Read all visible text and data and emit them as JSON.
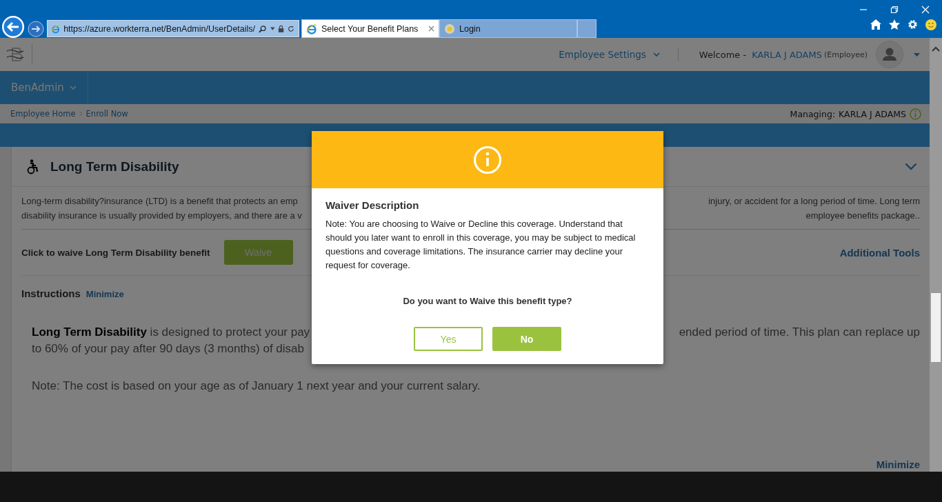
{
  "browser": {
    "address": "https://azure.workterra.net/BenAdmin/UserDetails/",
    "tabs": [
      {
        "title": "Select Your Benefit Plans",
        "selected": true
      },
      {
        "title": "Login",
        "selected": false
      }
    ]
  },
  "header": {
    "settings": "Employee Settings",
    "welcome": "Welcome -",
    "user_name": "KARLA J ADAMS",
    "user_role": "(Employee)"
  },
  "nav": {
    "menu": "BenAdmin"
  },
  "breadcrumb": [
    "Employee Home",
    "Enroll Now"
  ],
  "managing": {
    "label": "Managing:",
    "name": "KARLA J ADAMS"
  },
  "benefit": {
    "title": "Long Term Disability",
    "description_lines": [
      {
        "left": "Long-term disability?insurance (LTD) is a benefit that protects an emp",
        "right": "injury, or accident for a long period of time. Long term"
      },
      {
        "left": "disability insurance is usually provided by employers, and there are a v",
        "right": "employee benefits package.."
      }
    ],
    "waive_label": "Click to waive Long Term Disability benefit",
    "waive_button": "Waive",
    "additional_tools": "Additional Tools",
    "instructions_title": "Instructions",
    "minimize": "Minimize",
    "instruction_lines": [
      {
        "left": "**Long Term Disability** is designed to protect your pay",
        "right": "ended period of time. This plan can replace up"
      },
      {
        "left": "to 60% of your pay after 90 days (3 months) of disab"
      }
    ],
    "note": "Note: The cost is based on your age as of January 1 next year and your current salary.",
    "minimize_bottom": "Minimize"
  },
  "modal": {
    "title": "Waiver Description",
    "message": "Note: You are choosing to Waive or Decline this coverage. Understand that should you later want to enroll in this coverage, you may be subject to medical questions and coverage limitations. The insurance carrier may decline your request for coverage.",
    "question": "Do you want to Waive this benefit type?",
    "buttons": [
      {
        "label": "Yes",
        "kind": "outline"
      },
      {
        "label": "No",
        "kind": "primary"
      }
    ]
  }
}
